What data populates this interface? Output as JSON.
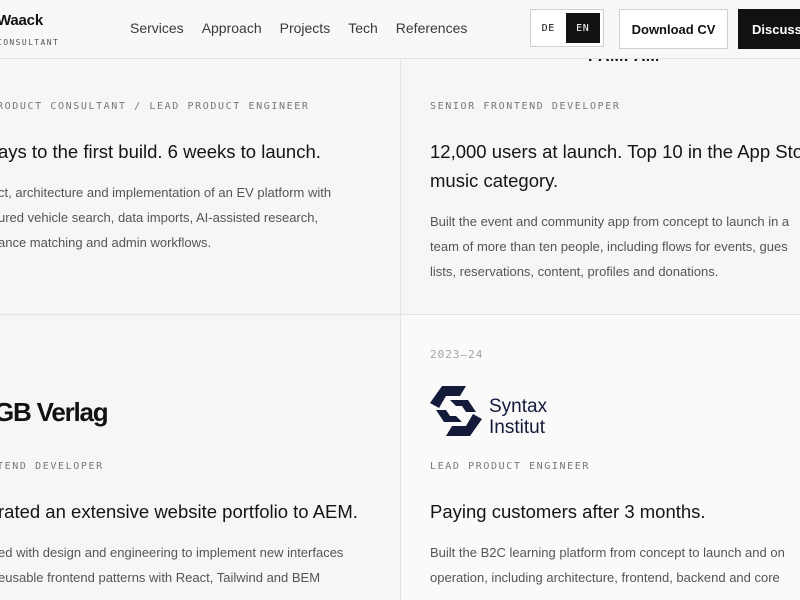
{
  "header": {
    "brand_name": "Waack",
    "brand_subtitle": "CONSULTANT",
    "nav": [
      "Services",
      "Approach",
      "Projects",
      "Tech",
      "References"
    ],
    "lang": {
      "de": "DE",
      "en": "EN",
      "active": "EN"
    },
    "download_cv": "Download CV",
    "discuss": "Discuss"
  },
  "projects": {
    "top_left": {
      "role": "RODUCT CONSULTANT / LEAD PRODUCT ENGINEER",
      "headline": "ays to the first build. 6 weeks to launch.",
      "body": [
        "ct, architecture and implementation of an EV platform with",
        "ured vehicle search, data imports, AI-assisted research,",
        "ance matching and admin workflows."
      ]
    },
    "top_right": {
      "logo_text": "PAMPAM",
      "role": "SENIOR FRONTEND DEVELOPER",
      "headline": [
        "12,000 users at launch. Top 10 in the App Sto",
        "music category."
      ],
      "body": [
        "Built the event and community app from concept to launch in a",
        "team of more than ten people, including flows for events, gues",
        "lists, reservations, content, profiles and donations."
      ]
    },
    "bottom_left": {
      "logo_text": "GB Verlag",
      "role": "TEND DEVELOPER",
      "headline": "rated an extensive website portfolio to AEM.",
      "body": [
        "ed with design and engineering to implement new interfaces",
        "eusable frontend patterns with React, Tailwind and BEM"
      ]
    },
    "bottom_right": {
      "year": "2023–24",
      "logo_text": [
        "Syntax",
        "Institut"
      ],
      "role": "LEAD PRODUCT ENGINEER",
      "headline": "Paying customers after 3 months.",
      "body": [
        "Built the B2C learning platform from concept to launch and on",
        "operation, including architecture, frontend, backend and core"
      ]
    }
  },
  "colors": {
    "accent": "#111111",
    "syntax_logo": "#141a3a"
  },
  "icons": [
    "partial-logo-icon",
    "partial-logo-icon",
    "syntax-institut-logo-icon"
  ]
}
